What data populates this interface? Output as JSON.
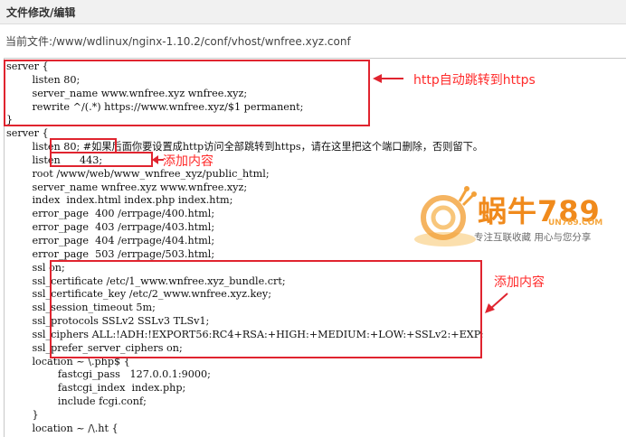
{
  "window": {
    "title": "文件修改/编辑"
  },
  "path": {
    "label": "当前文件:/www/wdlinux/nginx-1.10.2/conf/vhost/wnfree.xyz.conf"
  },
  "code_lines": [
    "server {",
    "        listen 80;",
    "        server_name www.wnfree.xyz wnfree.xyz;",
    "        rewrite ^/(.*) https://www.wnfree.xyz/$1 permanent;",
    "}",
    "server {",
    "        listen 80; #如果后面你要设置成http访问全部跳转到https，请在这里把这个端口删除，否则留下。",
    "        listen      443;",
    "        root /www/web/www_wnfree_xyz/public_html;",
    "        server_name wnfree.xyz www.wnfree.xyz;",
    "        index  index.html index.php index.htm;",
    "        error_page  400 /errpage/400.html;",
    "        error_page  403 /errpage/403.html;",
    "        error_page  404 /errpage/404.html;",
    "        error_page  503 /errpage/503.html;",
    "        ssl on;",
    "        ssl_certificate /etc/1_www.wnfree.xyz_bundle.crt;",
    "        ssl_certificate_key /etc/2_www.wnfree.xyz.key;",
    "        ssl_session_timeout 5m;",
    "        ssl_protocols SSLv2 SSLv3 TLSv1;",
    "        ssl_ciphers ALL:!ADH:!EXPORT56:RC4+RSA:+HIGH:+MEDIUM:+LOW:+SSLv2:+EXP;",
    "        ssl_prefer_server_ciphers on;",
    "        location ~ \\.php$ {",
    "                fastcgi_pass   127.0.0.1:9000;",
    "                fastcgi_index  index.php;",
    "                include fcgi.conf;",
    "        }",
    "        location ~ /\\.ht {"
  ],
  "annotations": {
    "redirect": "http自动跳转到https",
    "add_listen": "添加内容",
    "add_ssl": "添加内容"
  },
  "watermark": {
    "brand": "蜗牛789",
    "domain": "UN789.COM",
    "slogan": "专注互联收藏   用心与您分享"
  },
  "colors": {
    "annotation": "#e0242f",
    "watermark": "#f08a1c"
  }
}
